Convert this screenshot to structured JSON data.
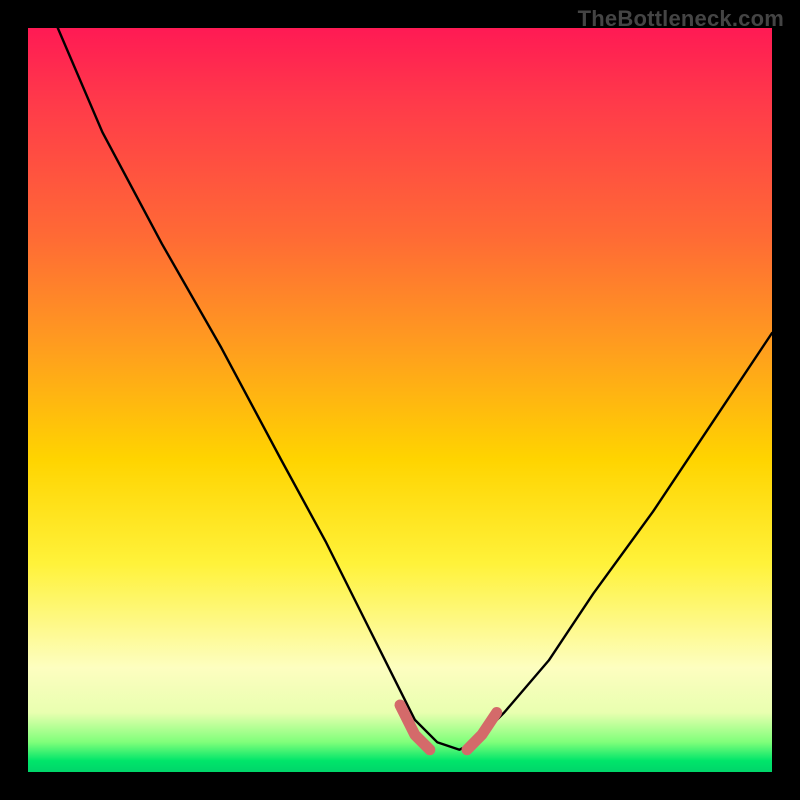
{
  "watermark": {
    "text": "TheBottleneck.com"
  },
  "colors": {
    "background": "#000000",
    "curve_stroke": "#000000",
    "highlight_stroke": "#d46a6a",
    "gradient_top": "#ff1a54",
    "gradient_bottom": "#00d56a",
    "watermark_text": "#444444"
  },
  "chart_data": {
    "type": "line",
    "title": "",
    "xlabel": "",
    "ylabel": "",
    "xlim": [
      0,
      100
    ],
    "ylim": [
      0,
      100
    ],
    "grid": false,
    "legend": "none",
    "notes": "Black V-shaped curve plotted over a vertical red-to-green gradient. Pink highlight segments mark the trough region. Approximate values read from image (y=0 is bottom green band, y=100 is top red edge).",
    "series": [
      {
        "name": "bottleneck-curve",
        "x": [
          4,
          10,
          18,
          26,
          34,
          40,
          46,
          50,
          52,
          55,
          58,
          60,
          64,
          70,
          76,
          84,
          92,
          100
        ],
        "y": [
          100,
          86,
          71,
          57,
          42,
          31,
          19,
          11,
          7,
          4,
          3,
          4,
          8,
          15,
          24,
          35,
          47,
          59
        ]
      }
    ],
    "highlights": [
      {
        "name": "left-trough-marker",
        "x": [
          50,
          52,
          54
        ],
        "y": [
          9,
          5,
          3
        ]
      },
      {
        "name": "right-trough-marker",
        "x": [
          59,
          61,
          63
        ],
        "y": [
          3,
          5,
          8
        ]
      }
    ]
  }
}
